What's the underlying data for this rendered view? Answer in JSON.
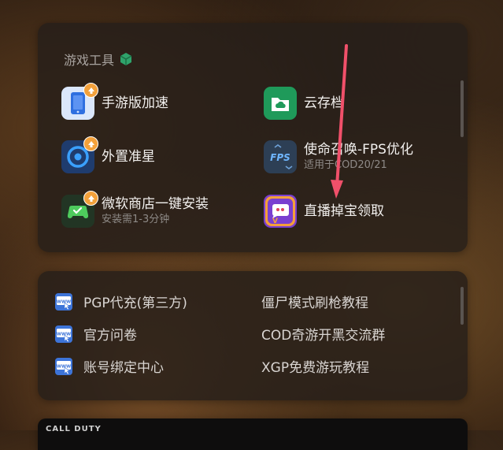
{
  "tools_section": {
    "title": "游戏工具",
    "items": [
      {
        "name": "手游版加速",
        "sub": "",
        "icon": "phone-boost-icon"
      },
      {
        "name": "云存档",
        "sub": "",
        "icon": "cloud-folder-icon"
      },
      {
        "name": "外置准星",
        "sub": "",
        "icon": "crosshair-icon"
      },
      {
        "name": "使命召唤-FPS优化",
        "sub": "适用于COD20/21",
        "icon": "fps-icon"
      },
      {
        "name": "微软商店一键安装",
        "sub": "安装需1-3分钟",
        "icon": "controller-icon"
      },
      {
        "name": "直播掉宝领取",
        "sub": "",
        "icon": "live-drops-icon"
      }
    ]
  },
  "links_section": {
    "left": [
      "PGP代充(第三方)",
      "官方问卷",
      "账号绑定中心"
    ],
    "right": [
      "僵尸模式刷枪教程",
      "COD奇游开黑交流群",
      "XGP免费游玩教程"
    ]
  },
  "bottom_card": {
    "text": "CALL DUTY"
  },
  "colors": {
    "accent_badge": "#f3a13b",
    "annotation_arrow": "#f0506a",
    "www_icon": "#3d74d8"
  }
}
